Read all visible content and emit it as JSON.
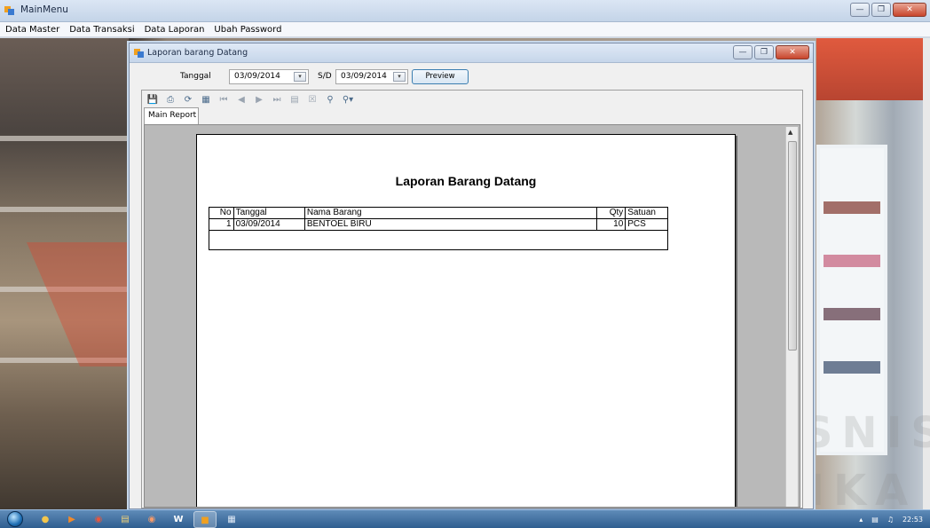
{
  "main_window": {
    "title": "MainMenu",
    "menu": [
      "Data Master",
      "Data Transaksi",
      "Data Laporan",
      "Ubah Password"
    ]
  },
  "child_window": {
    "title": "Laporan barang Datang",
    "tanggal_label": "Tanggal",
    "date_from": "03/09/2014",
    "sd_label": "S/D",
    "date_to": "03/09/2014",
    "preview_label": "Preview"
  },
  "viewer": {
    "tab_label": "Main Report",
    "toolbar_icons": [
      "export-icon",
      "print-icon",
      "refresh-icon",
      "group-tree-icon",
      "first-page-icon",
      "prev-page-icon",
      "next-page-icon",
      "last-page-icon",
      "goto-page-icon",
      "close-view-icon",
      "find-icon",
      "zoom-icon"
    ]
  },
  "report": {
    "title": "Laporan Barang Datang",
    "columns": [
      "No",
      "Tanggal",
      "Nama Barang",
      "Qty",
      "Satuan"
    ],
    "rows": [
      {
        "no": "1",
        "tanggal": "03/09/2014",
        "nama_barang": "BENTOEL BIRU",
        "qty": "10",
        "satuan": "PCS"
      }
    ]
  },
  "watermark": {
    "line1": "INSTITUT BISNIS",
    "line2": "& INFORMATIKA"
  },
  "taskbar": {
    "clock": "22:53"
  }
}
